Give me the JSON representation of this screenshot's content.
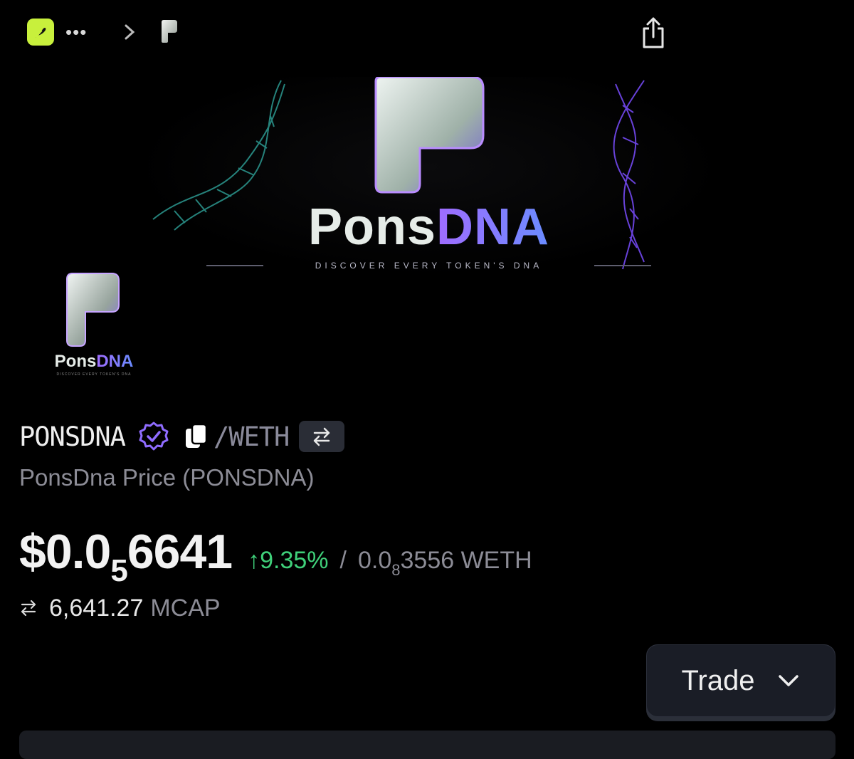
{
  "topbar": {
    "app_icon": "feather-app-icon",
    "more_icon": "ellipsis-icon",
    "more_label": "•••",
    "chevron_icon": "chevron-right-icon",
    "token_icon": "pons-p-icon",
    "share_icon": "share-icon"
  },
  "banner": {
    "wordmark_a": "Pons",
    "wordmark_b": "DNA",
    "tagline": "DISCOVER EVERY TOKEN'S DNA"
  },
  "logo": {
    "wordmark_a": "Pons",
    "wordmark_b": "DNA",
    "tagline": "DISCOVER EVERY TOKEN'S DNA"
  },
  "token": {
    "symbol": "PONSDNA",
    "pair": "/WETH",
    "subtitle": "PonsDna Price (PONSDNA)",
    "verified_icon": "verified-badge-icon",
    "copy_icon": "copy-icon",
    "swap_icon": "swap-arrows-icon"
  },
  "price": {
    "prefix": "$0.0",
    "zeros_sub": "5",
    "digits": "6641",
    "change": "↑9.35%",
    "separator": "/",
    "weth_prefix": "0.0",
    "weth_zeros_sub": "8",
    "weth_digits": "3556 WETH",
    "change_color": "#3fd07a"
  },
  "mcap": {
    "value": "6,641.27",
    "label": "MCAP"
  },
  "trade": {
    "label": "Trade"
  }
}
